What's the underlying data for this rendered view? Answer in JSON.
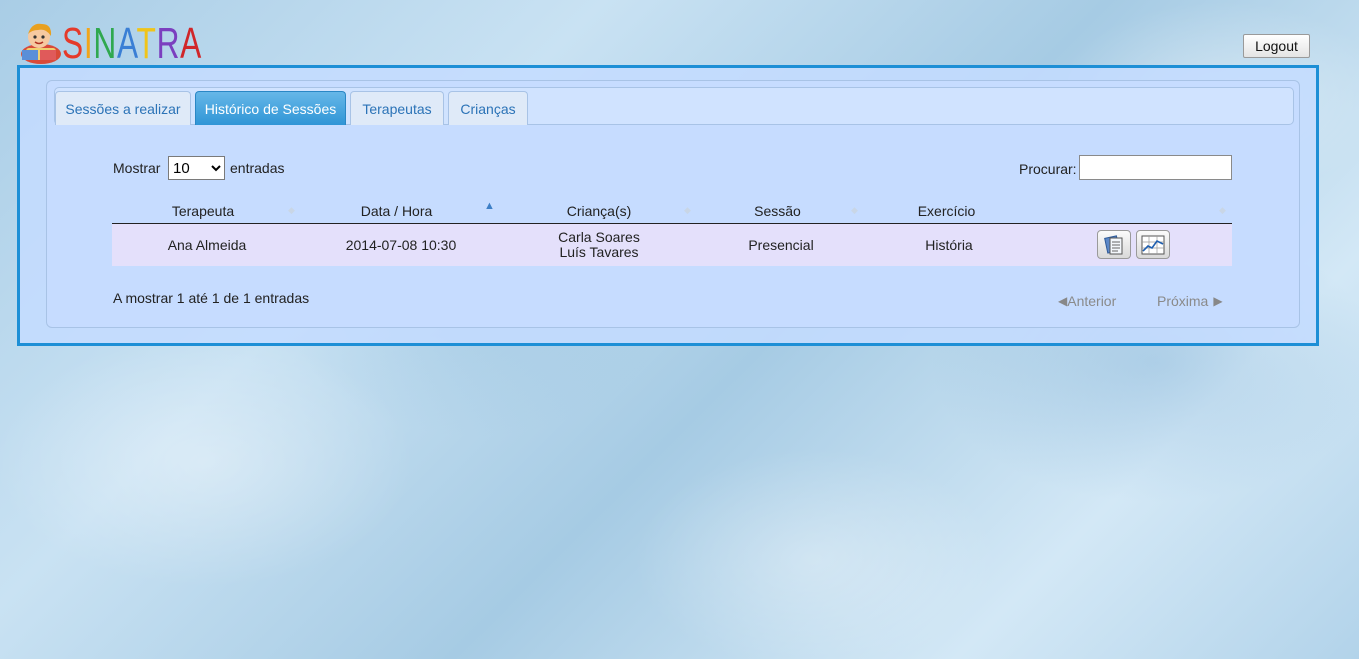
{
  "app": {
    "logo_text": "SINATRA",
    "logout_label": "Logout"
  },
  "tabs": [
    {
      "label": "Sessões a realizar",
      "active": false
    },
    {
      "label": "Histórico de Sessões",
      "active": true
    },
    {
      "label": "Terapeutas",
      "active": false
    },
    {
      "label": "Crianças",
      "active": false
    }
  ],
  "table_controls": {
    "show_label": "Mostrar",
    "page_size": "10",
    "page_size_options": [
      "10"
    ],
    "entries_label": "entradas",
    "search_label": "Procurar:",
    "search_value": ""
  },
  "table": {
    "columns": [
      "Terapeuta",
      "Data / Hora",
      "Criança(s)",
      "Sessão",
      "Exercício",
      ""
    ],
    "rows": [
      {
        "therapist": "Ana Almeida",
        "datetime": "2014-07-08 10:30",
        "children": [
          "Carla Soares",
          "Luís Tavares"
        ],
        "session": "Presencial",
        "exercise": "História",
        "actions": [
          "report-icon",
          "chart-icon"
        ]
      }
    ]
  },
  "footer": {
    "info": "A mostrar 1 até 1 de 1 entradas",
    "prev_label": "Anterior",
    "next_label": "Próxima"
  },
  "colors": {
    "accent": "#1d8fd6",
    "tab_active": "#3a9bd9",
    "row_bg": "#e4e0fb",
    "logo_letters": [
      "#e53a2a",
      "#f2a51a",
      "#2fa84f",
      "#3a7fd5",
      "#f0c419",
      "#7b3fbf",
      "#d0262a"
    ]
  }
}
